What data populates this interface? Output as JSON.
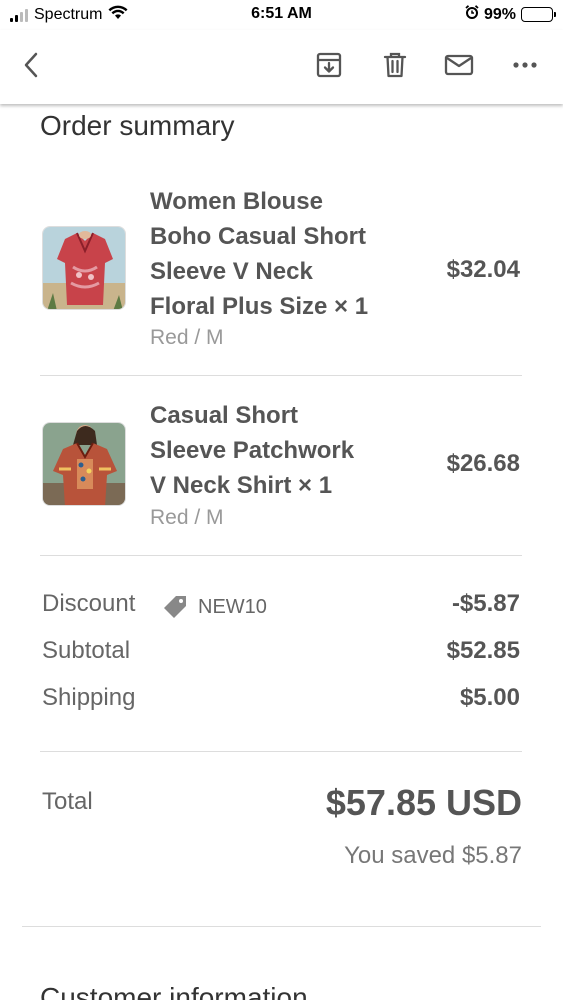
{
  "status_bar": {
    "carrier": "Spectrum",
    "time": "6:51 AM",
    "battery": "99%",
    "icons": [
      "signal-icon",
      "wifi-icon",
      "alarm-icon",
      "battery-icon"
    ]
  },
  "toolbar": {
    "icons": [
      "back-arrow-icon",
      "archive-icon",
      "trash-icon",
      "mail-icon",
      "more-icon"
    ]
  },
  "order_summary": {
    "title": "Order summary",
    "items": [
      {
        "title_lines": [
          "Women Blouse",
          "Boho Casual Short",
          "Sleeve V Neck",
          "Floral Plus Size × 1"
        ],
        "variant": "Red / M",
        "price": "$32.04"
      },
      {
        "title_lines": [
          "Casual Short",
          "Sleeve Patchwork",
          "V Neck Shirt × 1"
        ],
        "variant": "Red / M",
        "price": "$26.68"
      }
    ],
    "discount": {
      "label": "Discount",
      "code": "NEW10",
      "value": "-$5.87"
    },
    "subtotal": {
      "label": "Subtotal",
      "value": "$52.85"
    },
    "shipping": {
      "label": "Shipping",
      "value": "$5.00"
    },
    "total": {
      "label": "Total",
      "value": "$57.85 USD"
    },
    "saved": "You saved $5.87"
  },
  "customer_information": {
    "title": "Customer information"
  },
  "colors": {
    "text": "#555555",
    "muted": "#999999",
    "divider": "#dddddd",
    "background": "#ffffff"
  }
}
